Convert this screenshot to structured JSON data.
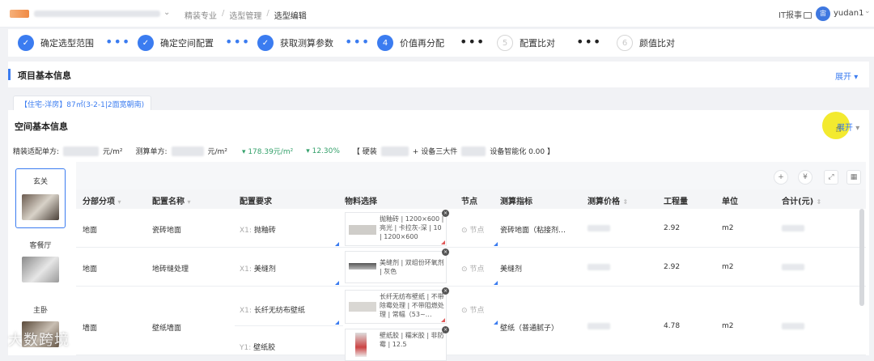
{
  "topbar": {
    "breadcrumb": [
      "精装专业",
      "选型管理",
      "选型编辑"
    ],
    "it_report": "IT报事",
    "avatar_text": "宙",
    "username": "yudan1"
  },
  "steps": [
    {
      "label": "确定选型范围",
      "state": "done",
      "mark": "✓"
    },
    {
      "label": "确定空间配置",
      "state": "done",
      "mark": "✓"
    },
    {
      "label": "获取测算参数",
      "state": "done",
      "mark": "✓"
    },
    {
      "label": "价值再分配",
      "state": "current",
      "mark": "4"
    },
    {
      "label": "配置比对",
      "state": "todo",
      "mark": "5"
    },
    {
      "label": "颜值比对",
      "state": "todo",
      "mark": "6"
    }
  ],
  "project_card": {
    "title": "项目基本信息",
    "expand": "展开"
  },
  "tab": {
    "label": "【住宅-洋房】87㎡(3-2-1|2面宽朝南)"
  },
  "space_card": {
    "title": "空间基本信息",
    "expand": "展开"
  },
  "summary": {
    "unit_price_label": "精装适配单方:",
    "unit_price_unit": "元/m²",
    "calc_price_label": "测算单方:",
    "calc_price_unit": "元/m²",
    "delta_amount": "▾ 178.39元/m²",
    "delta_pct": "▾ 12.30%",
    "hard_label": "【 硬装",
    "equip_label": "+ 设备三大件",
    "smart_label": "设备智能化 0.00 】"
  },
  "rooms": [
    {
      "label": "玄关",
      "active": true
    },
    {
      "label": "客餐厅",
      "active": false
    },
    {
      "label": "主卧",
      "active": false
    }
  ],
  "toolbar": {
    "add": "+",
    "currency": "¥",
    "fullscreen": "⤢",
    "grid": "▦"
  },
  "table": {
    "headers": [
      "分部分项",
      "配置名称",
      "配置要求",
      "物料选择",
      "节点",
      "测算指标",
      "测算价格",
      "工程量",
      "单位",
      "合计(元)"
    ],
    "rows": [
      {
        "part": "地面",
        "name": "瓷砖地面",
        "req_code": "X1:",
        "req": "抛釉砖",
        "material": "抛釉砖 | 1200×600 | 亮光 | 卡拉灰-深 | 10 | 1200×600",
        "node": "节点",
        "metric": "瓷砖地面（粘接剂…",
        "qty": "2.92",
        "unit": "m2"
      },
      {
        "part": "地面",
        "name": "地砖缝处理",
        "req_code": "X1:",
        "req": "美缝剂",
        "material": "美缝剂 | 双组份环氧剂 | 灰色",
        "node": "节点",
        "metric": "美缝剂",
        "qty": "2.92",
        "unit": "m2"
      },
      {
        "part": "墙面",
        "name": "壁纸墙面",
        "req_code": "X1:",
        "req": "长纤无纺布壁纸",
        "material": "长纤无纺布壁纸 | 不带除霉处理 | 不带阻燃处理 | 常幅（53~…",
        "node": "节点",
        "metric": "壁纸（普通腻子）",
        "qty": "4.78",
        "unit": "m2"
      },
      {
        "part": "",
        "name": "",
        "req_code": "Y1:",
        "req": "壁纸胶",
        "material": "壁纸胶 | 糯米胶 | 非防霉 | 12.5",
        "node": "",
        "metric": "",
        "qty": "",
        "unit": ""
      }
    ]
  },
  "watermark": "大数跨境"
}
